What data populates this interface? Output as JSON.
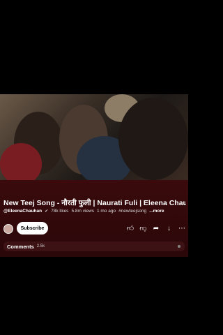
{
  "video": {
    "title": "New Teej Song - नौरती फुली | Naurati Fuli | Eleena Chau..."
  },
  "meta": {
    "channel": "@EleenaChauhan",
    "verified_icon": "verified-icon",
    "likes": "78k likes",
    "views": "5.8m views",
    "age": "1 mo ago",
    "hashtag": "#newteejsong",
    "more": "...more"
  },
  "channel_row": {
    "subscribe_label": "Subscribe",
    "icons": [
      "thumbs-up-icon",
      "thumbs-down-icon",
      "share-icon",
      "download-icon",
      "more-icon"
    ]
  },
  "comments": {
    "label": "Comments",
    "count": "2.5k"
  },
  "colors": {
    "panel_bg": "#3a0a0c",
    "subscribe_bg": "#ffffff"
  }
}
